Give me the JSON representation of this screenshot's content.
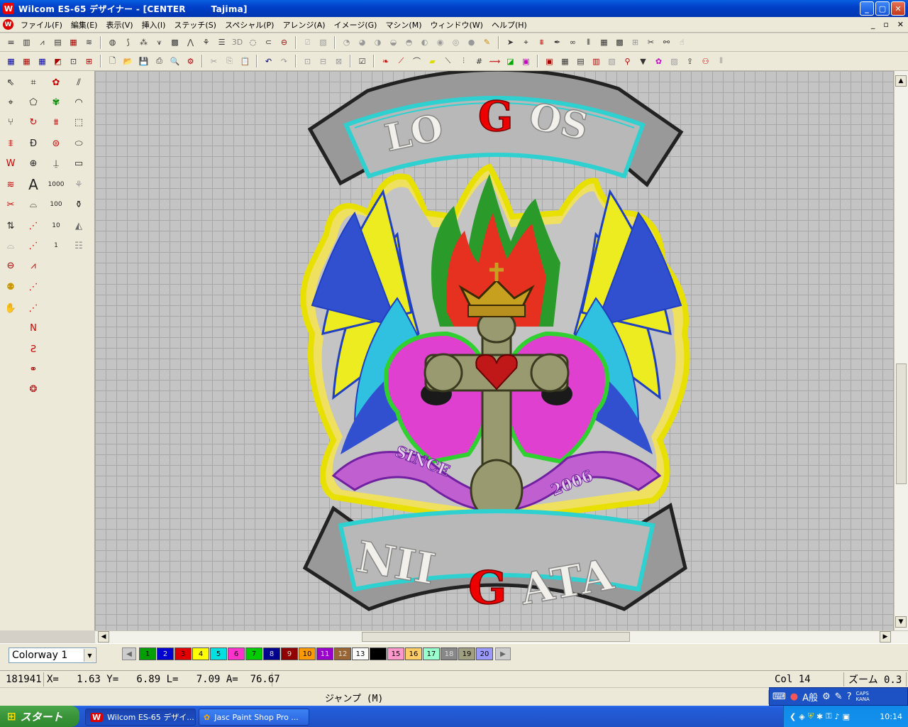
{
  "window": {
    "title": "Wilcom ES-65 デザイナー - [CENTER        Tajima]",
    "app_icon_letter": "W"
  },
  "window_controls": {
    "minimize": "_",
    "maximize": "▢",
    "close": "✕"
  },
  "mdi_controls": {
    "minimize": "_",
    "restore": "▫",
    "close": "✕"
  },
  "menu": [
    "ファイル(F)",
    "編集(E)",
    "表示(V)",
    "挿入(I)",
    "ステッチ(S)",
    "スペシャル(P)",
    "アレンジ(A)",
    "イメージ(G)",
    "マシン(M)",
    "ウィンドウ(W)",
    "ヘルプ(H)"
  ],
  "design": {
    "top_banner": "LOGOS",
    "top_red_letter": "G",
    "top_prefix": "LO",
    "top_suffix": "OS",
    "bottom_prefix": "NII",
    "bottom_red_letter": "G",
    "bottom_suffix": "ATA",
    "ribbon_left": "SINCE",
    "ribbon_right": "2006"
  },
  "colorway": {
    "selected": "Colorway 1"
  },
  "palette": [
    {
      "n": "1",
      "c": "#00a000"
    },
    {
      "n": "2",
      "c": "#0000d0"
    },
    {
      "n": "3",
      "c": "#e00000"
    },
    {
      "n": "4",
      "c": "#ffff00"
    },
    {
      "n": "5",
      "c": "#00e0e0"
    },
    {
      "n": "6",
      "c": "#ff33cc"
    },
    {
      "n": "7",
      "c": "#00cc00"
    },
    {
      "n": "8",
      "c": "#000090"
    },
    {
      "n": "9",
      "c": "#900000"
    },
    {
      "n": "10",
      "c": "#ff9900"
    },
    {
      "n": "11",
      "c": "#9900cc"
    },
    {
      "n": "12",
      "c": "#996633"
    },
    {
      "n": "13",
      "c": "#ffffff"
    },
    {
      "n": "14",
      "c": "#000000"
    },
    {
      "n": "15",
      "c": "#ff99cc"
    },
    {
      "n": "16",
      "c": "#ffcc66"
    },
    {
      "n": "17",
      "c": "#99ffcc"
    },
    {
      "n": "18",
      "c": "#888888"
    },
    {
      "n": "19",
      "c": "#a0a080"
    },
    {
      "n": "20",
      "c": "#9999ff"
    }
  ],
  "status": {
    "stitch_count": "181941",
    "coords": "X=   1.63 Y=   6.89 L=   7.09 A=  76.67",
    "col": "Col 14",
    "zoom": "ズーム 0.3"
  },
  "jump": "ジャンプ (M)",
  "ime": {
    "mode": "A般",
    "caps": "CAPS",
    "kana": "KANA"
  },
  "taskbar": {
    "start": "スタート",
    "task1": "Wilcom ES-65 デザイ...",
    "task2": "Jasc Paint Shop Pro ...",
    "clock": "10:14"
  }
}
